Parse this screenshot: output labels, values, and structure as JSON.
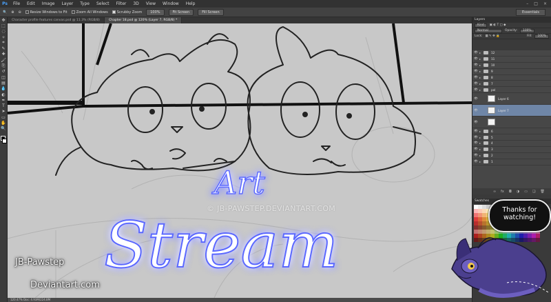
{
  "menu": [
    "File",
    "Edit",
    "Image",
    "Layer",
    "Type",
    "Select",
    "Filter",
    "3D",
    "View",
    "Window",
    "Help"
  ],
  "app_logo": "Ps",
  "options": {
    "resize_windows": "Resize Windows to Fit",
    "zoom_all": "Zoom All Windows",
    "scrubby": "Scrubby Zoom",
    "btn_100": "100%",
    "btn_fit": "Fit Screen",
    "btn_fill": "Fill Screen",
    "workspace": "Essentials"
  },
  "doc_tabs": [
    {
      "label": "Character profile features canvas.psd @ 11.3% (RGB/8)",
      "active": false
    },
    {
      "label": "Chapter 18.psd @ 120% (Layer 7, RGB/8) *",
      "active": true
    }
  ],
  "status": "120.47%   Doc: 4.93M/224.8M",
  "layers_panel": {
    "tabs": "Layers",
    "kind": "Kind",
    "mode": "Normal",
    "opacity_label": "Opacity:",
    "opacity": "100%",
    "lock_label": "Lock:",
    "fill_label": "Fill:",
    "fill": "100%",
    "items": [
      {
        "name": "12",
        "type": "folder"
      },
      {
        "name": "11",
        "type": "folder"
      },
      {
        "name": "10",
        "type": "folder"
      },
      {
        "name": "9",
        "type": "folder"
      },
      {
        "name": "8",
        "type": "folder"
      },
      {
        "name": "7",
        "type": "folder"
      },
      {
        "name": "pol",
        "type": "folder"
      },
      {
        "name": "Layer 6",
        "type": "layer"
      },
      {
        "name": "Layer 7",
        "type": "layer",
        "selected": true
      },
      {
        "name": "",
        "type": "layer"
      },
      {
        "name": "6",
        "type": "folder"
      },
      {
        "name": "5",
        "type": "folder"
      },
      {
        "name": "4",
        "type": "folder"
      },
      {
        "name": "3",
        "type": "folder"
      },
      {
        "name": "2",
        "type": "folder"
      },
      {
        "name": "1",
        "type": "folder"
      }
    ]
  },
  "swatches_panel": "Swatches",
  "overlay": {
    "art": "Art",
    "stream": "Stream",
    "watermark": "© JB-PAWSTEP.DEVIANTART.COM",
    "signature_line1": "JB-Pawstep",
    "signature_line2": "Deviantart.com",
    "bubble": "Thanks for watching!"
  },
  "colors": {
    "overlay_glow": "#4d5bff",
    "selected_layer": "#6f86a7",
    "canvas_bg": "#c8c8c8"
  },
  "icons": [
    "move-tool-icon",
    "marquee-tool-icon",
    "lasso-tool-icon",
    "quick-select-icon",
    "crop-tool-icon",
    "eyedropper-icon",
    "healing-brush-icon",
    "brush-tool-icon",
    "clone-stamp-icon",
    "history-brush-icon",
    "eraser-icon",
    "gradient-icon",
    "blur-icon",
    "dodge-icon",
    "pen-tool-icon",
    "type-tool-icon",
    "path-select-icon",
    "rectangle-tool-icon",
    "hand-tool-icon",
    "zoom-tool-icon"
  ]
}
